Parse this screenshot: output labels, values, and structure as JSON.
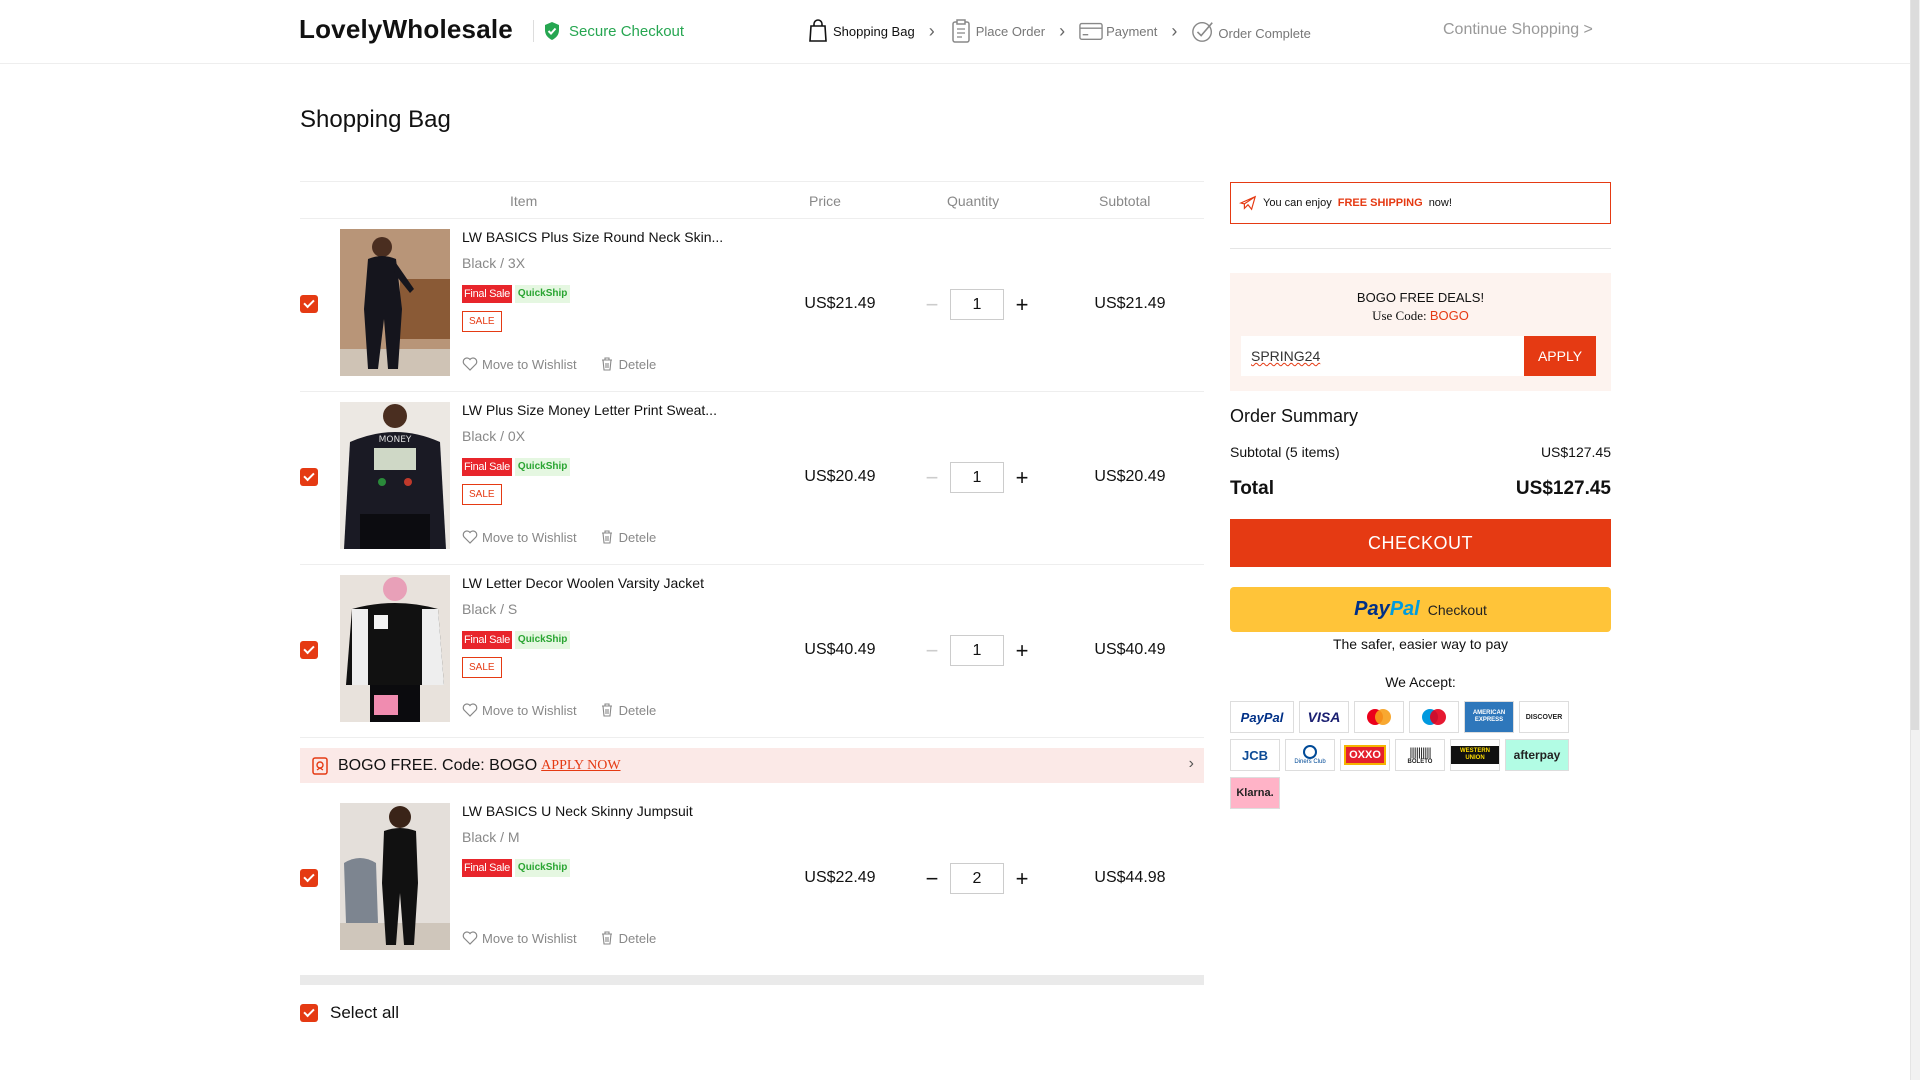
{
  "header": {
    "logo": "LovelyWholesale",
    "secure": "Secure Checkout",
    "steps": [
      {
        "label": "Shopping Bag",
        "icon": "bag-icon",
        "active": true
      },
      {
        "label": "Place Order",
        "icon": "clipboard-icon",
        "active": false
      },
      {
        "label": "Payment",
        "icon": "card-icon",
        "active": false
      },
      {
        "label": "Order Complete",
        "icon": "check-circle-icon",
        "active": false
      }
    ],
    "continue": "Continue Shopping >"
  },
  "page_title": "Shopping Bag",
  "table_head": {
    "item": "Item",
    "price": "Price",
    "quantity": "Quantity",
    "subtotal": "Subtotal"
  },
  "items": [
    {
      "name": "LW BASICS Plus Size Round Neck Skin...",
      "variant": "Black / 3X",
      "final_sale": "Final Sale",
      "quickship": "QuickShip",
      "sale": "SALE",
      "price": "US$21.49",
      "qty": "1",
      "subtotal": "US$21.49",
      "wishlist": "Move to Wishlist",
      "delete": "Detele"
    },
    {
      "name": "LW Plus Size Money Letter Print Sweat...",
      "variant": "Black / 0X",
      "final_sale": "Final Sale",
      "quickship": "QuickShip",
      "sale": "SALE",
      "price": "US$20.49",
      "qty": "1",
      "subtotal": "US$20.49",
      "wishlist": "Move to Wishlist",
      "delete": "Detele"
    },
    {
      "name": "LW Letter Decor Woolen Varsity Jacket",
      "variant": "Black / S",
      "final_sale": "Final Sale",
      "quickship": "QuickShip",
      "sale": "SALE",
      "price": "US$40.49",
      "qty": "1",
      "subtotal": "US$40.49",
      "wishlist": "Move to Wishlist",
      "delete": "Detele"
    },
    {
      "name": "LW BASICS U Neck Skinny Jumpsuit",
      "variant": "Black / M",
      "final_sale": "Final Sale",
      "quickship": "QuickShip",
      "price": "US$22.49",
      "qty": "2",
      "subtotal": "US$44.98",
      "wishlist": "Move to Wishlist",
      "delete": "Detele"
    }
  ],
  "bogo_bar": {
    "text": "BOGO FREE. Code: BOGO",
    "link": "APPLY NOW"
  },
  "select_all": "Select all",
  "shipping": {
    "prefix": "You can enjoy",
    "highlight": "FREE SHIPPING",
    "suffix": "now!"
  },
  "bogo_box": {
    "title": "BOGO FREE DEALS!",
    "use_code": "Use Code:",
    "code": "BOGO",
    "coupon_value": "SPRING24",
    "apply": "APPLY"
  },
  "summary": {
    "title": "Order Summary",
    "subtotal_label": "Subtotal (5 items)",
    "subtotal_value": "US$127.45",
    "total_label": "Total",
    "total_value": "US$127.45"
  },
  "checkout": "CHECKOUT",
  "paypal": {
    "pay": "Pay",
    "pal": "Pal",
    "checkout": "Checkout",
    "tagline": "The safer, easier way to pay"
  },
  "we_accept": "We Accept:",
  "cards": [
    "PayPal",
    "VISA",
    "Mastercard",
    "Maestro",
    "AMERICAN EXPRESS",
    "DISCOVER",
    "JCB",
    "Diners Club",
    "OXXO",
    "BOLETO",
    "WESTERN UNION",
    "afterpay",
    "Klarna."
  ],
  "colors": {
    "accent": "#e53a13",
    "secure_green": "#26a651",
    "paypal_yellow": "#ffc439"
  }
}
